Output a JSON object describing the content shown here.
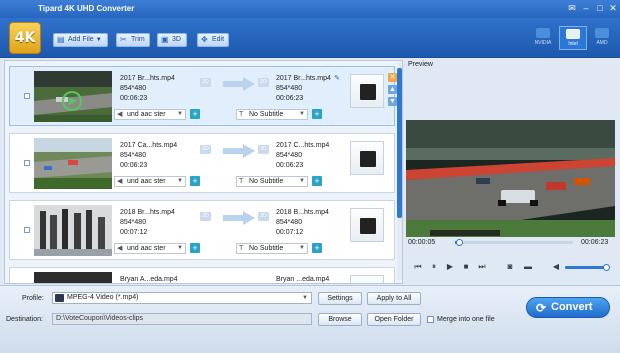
{
  "app": {
    "title": "Tipard 4K UHD Converter",
    "logo_text": "4K"
  },
  "toolbar": {
    "add_file": "Add File",
    "trim": "Trim",
    "3d": "3D",
    "edit": "Edit",
    "gpu": [
      "NVIDIA",
      "Intel",
      "AMD"
    ],
    "gpu_active": "Intel"
  },
  "files": [
    {
      "src_name": "2017 Br...hts.mp4",
      "src_res": "854*480",
      "src_dur": "00:06:23",
      "dst_name": "2017 Br...hts.mp4",
      "dst_res": "854*480",
      "dst_dur": "00:06:23",
      "audio": "und aac ster",
      "subtitle": "No Subtitle",
      "selected": true
    },
    {
      "src_name": "2017 Ca...hts.mp4",
      "src_res": "854*480",
      "src_dur": "00:06:23",
      "dst_name": "2017 C...hts.mp4",
      "dst_res": "854*480",
      "dst_dur": "00:06:23",
      "audio": "und aac ster",
      "subtitle": "No Subtitle",
      "selected": false
    },
    {
      "src_name": "2018 Br...hts.mp4",
      "src_res": "854*480",
      "src_dur": "00:07:12",
      "dst_name": "2018 B...hts.mp4",
      "dst_res": "854*480",
      "dst_dur": "00:07:12",
      "audio": "und aac ster",
      "subtitle": "No Subtitle",
      "selected": false
    },
    {
      "src_name": "Bryan A...eda.mp4",
      "dst_name": "Bryan ...eda.mp4"
    }
  ],
  "res_tag": "2D",
  "preview": {
    "label": "Preview",
    "current_time": "00:00:05",
    "total_time": "00:06:23",
    "progress": 0.013,
    "volume": 1.0
  },
  "bottom": {
    "profile_label": "Profile:",
    "profile_value": "MPEG-4 Video (*.mp4)",
    "settings": "Settings",
    "apply_all": "Apply to All",
    "destination_label": "Destination:",
    "destination_value": "D:\\VoteCoupon\\Videos-clips",
    "browse": "Browse",
    "open_folder": "Open Folder",
    "merge_label": "Merge into one file",
    "convert": "Convert"
  }
}
